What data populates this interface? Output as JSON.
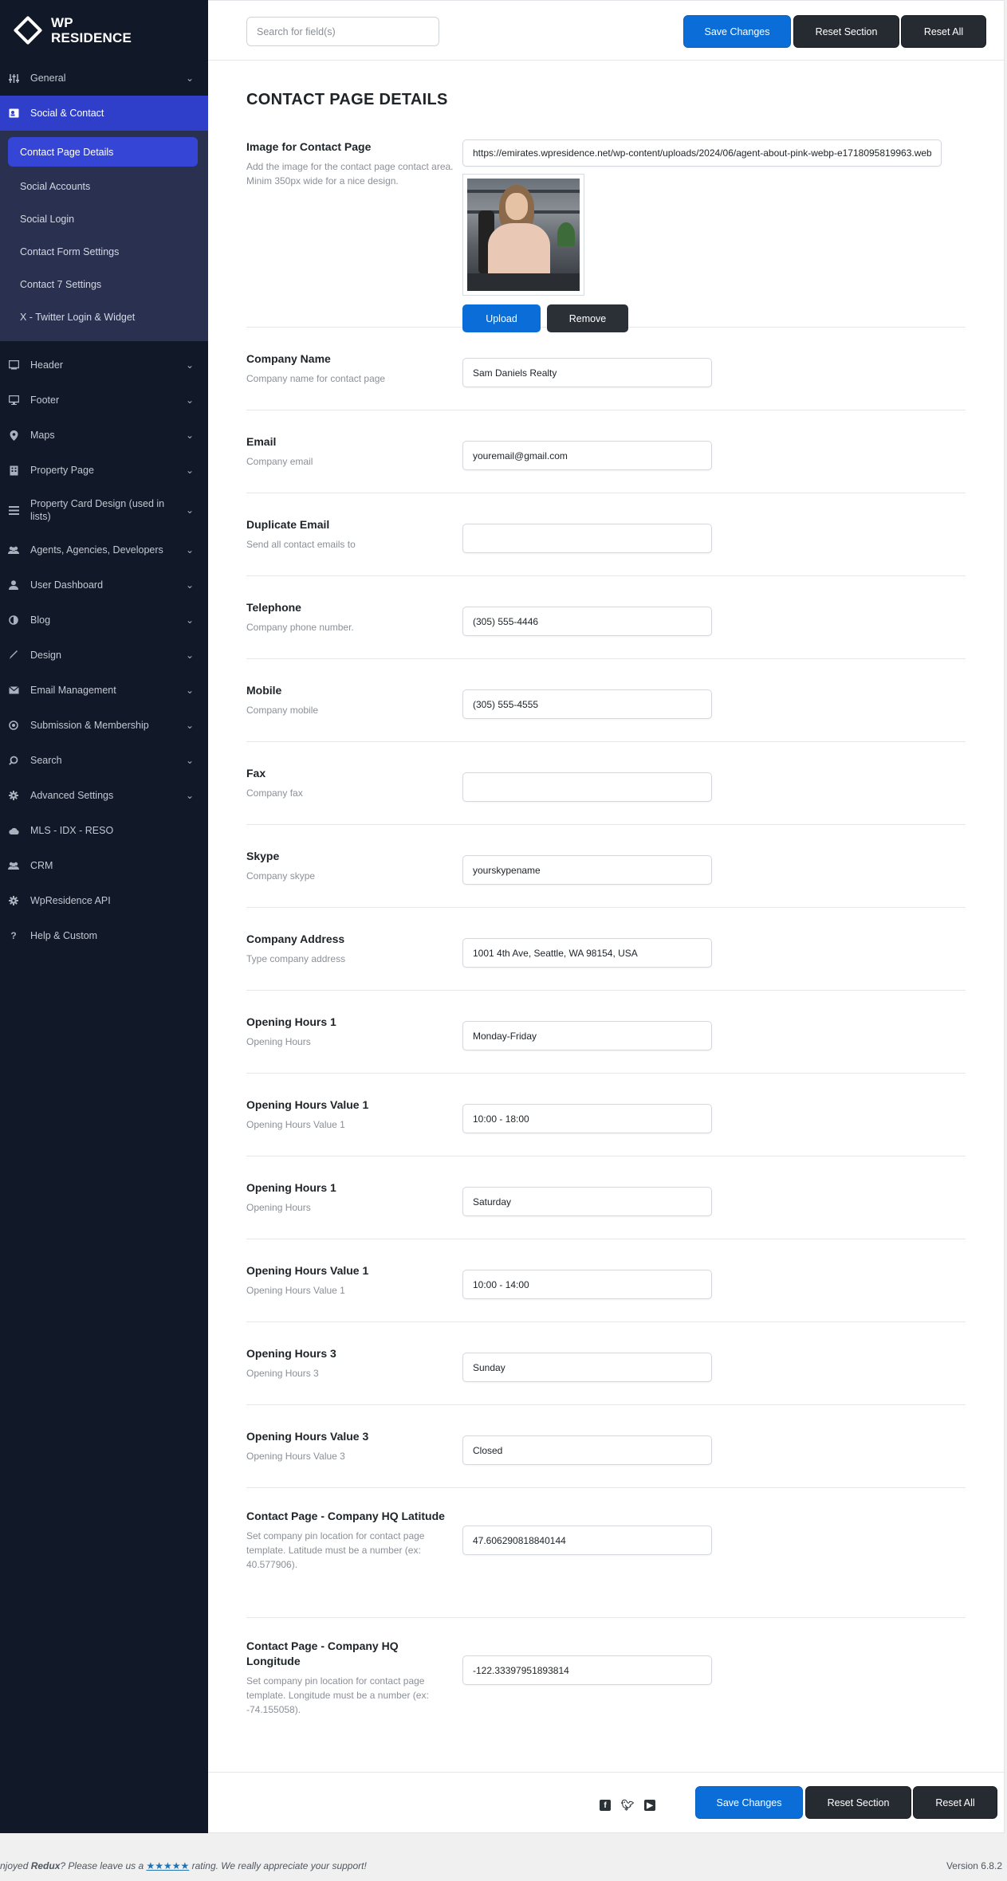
{
  "brand": {
    "line1": "WP",
    "line2": "RESIDENCE"
  },
  "sidebar": {
    "items": [
      {
        "label": "General",
        "icon": "sliders-icon",
        "chevron": true
      },
      {
        "label": "Social & Contact",
        "icon": "contact-card-icon",
        "chevron": false,
        "active": true
      }
    ],
    "subitems": [
      {
        "label": "Contact Page Details",
        "active": true
      },
      {
        "label": "Social Accounts"
      },
      {
        "label": "Social Login"
      },
      {
        "label": "Contact Form Settings"
      },
      {
        "label": "Contact 7 Settings"
      },
      {
        "label": "X - Twitter Login & Widget"
      }
    ],
    "more": [
      {
        "label": "Header",
        "icon": "monitor-icon",
        "chevron": true
      },
      {
        "label": "Footer",
        "icon": "desktop-icon",
        "chevron": true
      },
      {
        "label": "Maps",
        "icon": "map-pin-icon",
        "chevron": true
      },
      {
        "label": "Property Page",
        "icon": "building-icon",
        "chevron": true
      },
      {
        "label": "Property Card Design (used in lists)",
        "icon": "list-icon",
        "chevron": true,
        "tall": true
      },
      {
        "label": "Agents, Agencies, Developers",
        "icon": "users-icon",
        "chevron": true
      },
      {
        "label": "User Dashboard",
        "icon": "user-icon",
        "chevron": true
      },
      {
        "label": "Blog",
        "icon": "contrast-icon",
        "chevron": true
      },
      {
        "label": "Design",
        "icon": "brush-icon",
        "chevron": true
      },
      {
        "label": "Email Management",
        "icon": "envelope-icon",
        "chevron": true
      },
      {
        "label": "Submission & Membership",
        "icon": "circle-plus-icon",
        "chevron": true
      },
      {
        "label": "Search",
        "icon": "search-icon",
        "chevron": true
      },
      {
        "label": "Advanced Settings",
        "icon": "gear-icon",
        "chevron": true
      },
      {
        "label": "MLS - IDX - RESO",
        "icon": "cloud-icon",
        "chevron": false
      },
      {
        "label": "CRM",
        "icon": "group-icon",
        "chevron": false
      },
      {
        "label": "WpResidence API",
        "icon": "cog-icon",
        "chevron": false
      },
      {
        "label": "Help & Custom",
        "icon": "question-icon",
        "chevron": false
      }
    ]
  },
  "topbar": {
    "search_placeholder": "Search for field(s)",
    "save": "Save Changes",
    "reset_section": "Reset Section",
    "reset_all": "Reset All"
  },
  "page": {
    "title": "CONTACT PAGE DETAILS",
    "image_field": {
      "title": "Image for Contact Page",
      "desc": "Add the image for the contact page contact area. Minim 350px wide for a nice design.",
      "url": "https://emirates.wpresidence.net/wp-content/uploads/2024/06/agent-about-pink-webp-e1718095819963.webp",
      "upload": "Upload",
      "remove": "Remove"
    },
    "fields": [
      {
        "title": "Company Name",
        "desc": "Company name for contact page",
        "value": "Sam Daniels Realty"
      },
      {
        "title": "Email",
        "desc": "Company email",
        "value": "youremail@gmail.com"
      },
      {
        "title": "Duplicate Email",
        "desc": "Send all contact emails to",
        "value": ""
      },
      {
        "title": "Telephone",
        "desc": "Company phone number.",
        "value": "(305) 555-4446"
      },
      {
        "title": "Mobile",
        "desc": "Company mobile",
        "value": "(305) 555-4555"
      },
      {
        "title": "Fax",
        "desc": "Company fax",
        "value": ""
      },
      {
        "title": "Skype",
        "desc": "Company skype",
        "value": "yourskypename"
      },
      {
        "title": "Company Address",
        "desc": "Type company address",
        "value": "1001 4th Ave, Seattle, WA 98154, USA"
      },
      {
        "title": "Opening Hours 1",
        "desc": "Opening Hours",
        "value": "Monday-Friday"
      },
      {
        "title": "Opening Hours Value 1",
        "desc": "Opening Hours Value 1",
        "value": "10:00 - 18:00"
      },
      {
        "title": "Opening Hours 1",
        "desc": "Opening Hours",
        "value": "Saturday"
      },
      {
        "title": "Opening Hours Value 1",
        "desc": "Opening Hours Value 1",
        "value": "10:00 - 14:00"
      },
      {
        "title": "Opening Hours 3",
        "desc": "Opening Hours 3",
        "value": "Sunday"
      },
      {
        "title": "Opening Hours Value 3",
        "desc": "Opening Hours Value 3",
        "value": "Closed"
      }
    ],
    "lat": {
      "title": "Contact Page - Company HQ Latitude",
      "desc": "Set company pin location for contact page template. Latitude must be a number (ex: 40.577906).",
      "value": "47.606290818840144"
    },
    "lng": {
      "title": "Contact Page - Company HQ Longitude",
      "desc": "Set company pin location for contact page template. Longitude must be a number (ex: -74.155058).",
      "value": "-122.33397951893814"
    }
  },
  "bottombar": {
    "save": "Save Changes",
    "reset_section": "Reset Section",
    "reset_all": "Reset All",
    "social": [
      "facebook-icon",
      "twitter-icon",
      "youtube-icon"
    ]
  },
  "footer": {
    "prefix": "njoyed ",
    "brand": "Redux",
    "middle": "? Please leave us a ",
    "stars": "★★★★★",
    "suffix": " rating. We really appreciate your support!",
    "version": "Version 6.8.2"
  },
  "colors": {
    "sidebar_bg": "#111827",
    "active_blue": "#2f3fc9",
    "primary": "#0b6ed8",
    "dark_btn": "#262b31"
  }
}
